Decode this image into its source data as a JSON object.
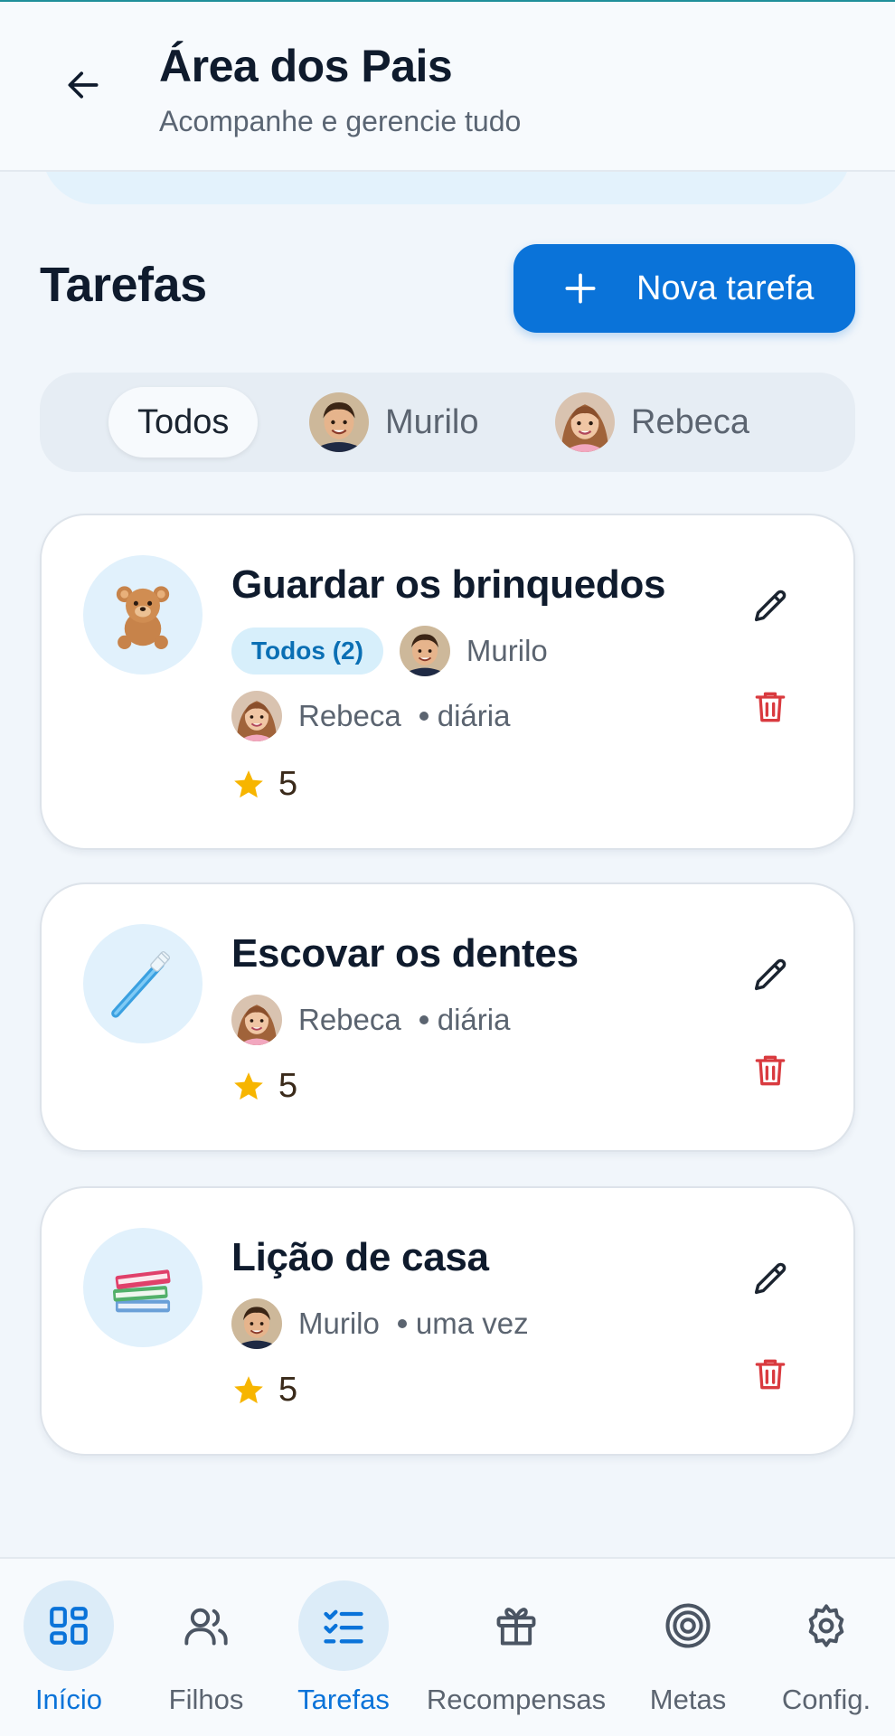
{
  "header": {
    "title": "Área dos Pais",
    "subtitle": "Acompanhe e gerencie tudo",
    "back_icon": "arrow-left-icon"
  },
  "section": {
    "title": "Tarefas",
    "new_task_label": "Nova tarefa"
  },
  "filters": [
    {
      "label": "Todos",
      "active": true
    },
    {
      "label": "Murilo",
      "active": false,
      "avatar": "boy-avatar"
    },
    {
      "label": "Rebeca",
      "active": false,
      "avatar": "girl-avatar"
    }
  ],
  "tasks": [
    {
      "title": "Guardar os brinquedos",
      "icon": "teddy-bear-icon",
      "badge": "Todos (2)",
      "assignees": [
        "Murilo",
        "Rebeca"
      ],
      "frequency": "diária",
      "stars": "5"
    },
    {
      "title": "Escovar os dentes",
      "icon": "toothbrush-icon",
      "assignees": [
        "Rebeca"
      ],
      "frequency": "diária",
      "stars": "5"
    },
    {
      "title": "Lição de casa",
      "icon": "books-icon",
      "assignees": [
        "Murilo"
      ],
      "frequency": "uma vez",
      "stars": "5"
    }
  ],
  "bottom_nav": [
    {
      "label": "Início",
      "icon": "dashboard-icon",
      "active": true
    },
    {
      "label": "Filhos",
      "icon": "people-icon",
      "active": false
    },
    {
      "label": "Tarefas",
      "icon": "checklist-icon",
      "active": true
    },
    {
      "label": "Recompensas",
      "icon": "gift-icon",
      "active": false
    },
    {
      "label": "Metas",
      "icon": "target-icon",
      "active": false
    },
    {
      "label": "Config.",
      "icon": "gear-icon",
      "active": false
    }
  ],
  "colors": {
    "primary": "#0a73d9",
    "danger": "#d93a3f",
    "star": "#f7b500",
    "background": "#f1f6fb"
  }
}
